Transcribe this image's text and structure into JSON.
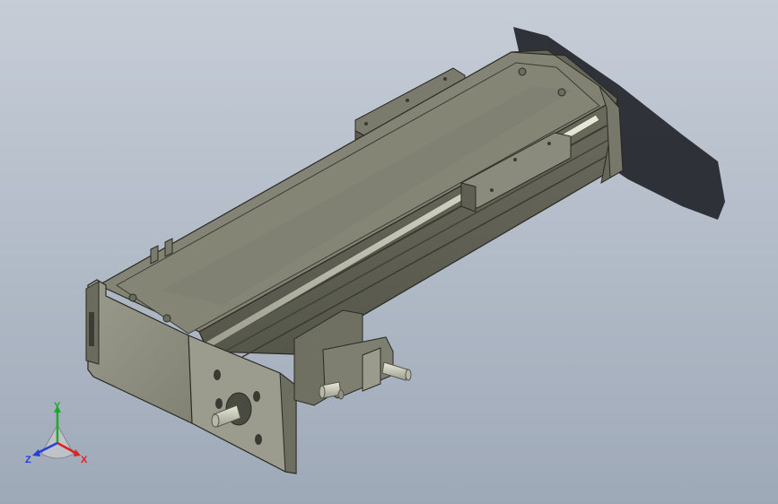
{
  "viewport": {
    "background_top": "#c6cdd7",
    "background_bottom": "#9ea9b8",
    "model": "linear-actuator-module"
  },
  "triad": {
    "x_label": "X",
    "y_label": "Y",
    "z_label": "Z",
    "x_color": "#e02020",
    "y_color": "#1fa82a",
    "z_color": "#2440d8"
  }
}
